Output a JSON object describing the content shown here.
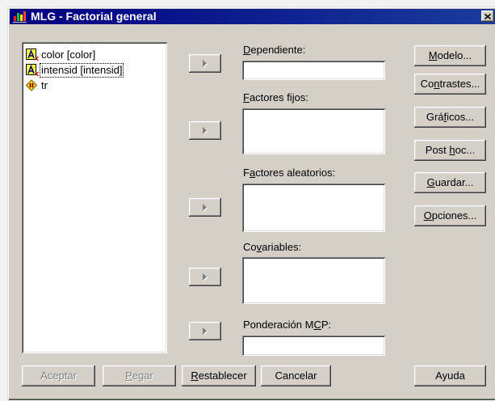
{
  "window": {
    "title": "MLG - Factorial general",
    "app_icon": "spss-app-icon",
    "close_icon": "close-icon"
  },
  "source_variables": [
    {
      "label": "color [color]",
      "icon": "string-variable-icon",
      "focused": false
    },
    {
      "label": "intensid [intensid]",
      "icon": "string-variable-icon",
      "focused": true
    },
    {
      "label": "tr",
      "icon": "scale-variable-icon",
      "focused": false
    }
  ],
  "move_button_icon": "right-arrow-icon",
  "targets": {
    "dependent": {
      "label": "Dependiente:"
    },
    "fixed_factors": {
      "label": "Factores fijos:"
    },
    "random_factors": {
      "label": "Factores aleatorios:"
    },
    "covariates": {
      "label": "Covariables:"
    },
    "wls_weight": {
      "label": "Ponderación MCP:"
    }
  },
  "side_buttons": {
    "model": "Modelo...",
    "contrasts": "Contrastes...",
    "plots": "Gráficos...",
    "post_hoc": "Post hoc...",
    "save": "Guardar...",
    "options": "Opciones..."
  },
  "bottom_buttons": {
    "ok": {
      "label": "Aceptar",
      "enabled": false
    },
    "paste": {
      "label": "Pegar",
      "enabled": false
    },
    "reset": {
      "label": "Restablecer",
      "enabled": true
    },
    "cancel": {
      "label": "Cancelar",
      "enabled": true
    },
    "help": {
      "label": "Ayuda",
      "enabled": true
    }
  },
  "colors": {
    "title_bar": "#000080",
    "title_bar_end": "#1a3c9c",
    "title_text": "#ffffff",
    "window_face": "#d4d0c8",
    "field_background": "#ffffff",
    "disabled_text": "#808080"
  }
}
